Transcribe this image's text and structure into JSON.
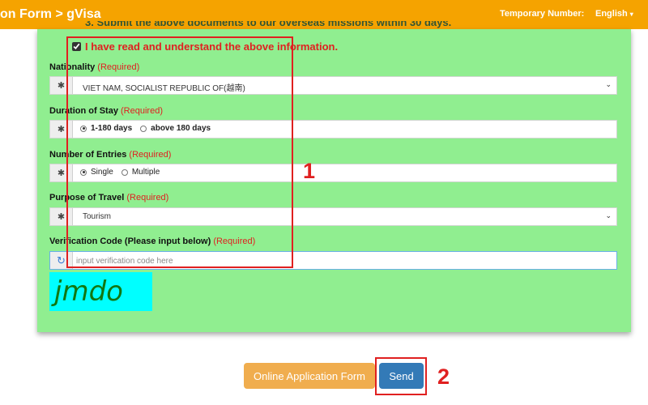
{
  "header": {
    "title": "on Form > gVisa",
    "temporary_label": "Temporary Number:",
    "language": "English",
    "language_caret": "▾"
  },
  "form": {
    "cut_off_text": "3. Submit the above documents to our overseas missions within 30 days.",
    "agree_text": "I have read and understand the above information.",
    "required_text": "(Required)",
    "nationality": {
      "label": "Nationality",
      "value": "VIET NAM, SOCIALIST REPUBLIC OF(越南)",
      "icon": "asterisk-icon"
    },
    "duration": {
      "label": "Duration of Stay",
      "options": [
        "1-180 days",
        "above 180 days"
      ],
      "selected": "1-180 days"
    },
    "entries": {
      "label": "Number of Entries",
      "options": [
        "Single",
        "Multiple"
      ],
      "selected": "Single"
    },
    "purpose": {
      "label": "Purpose of Travel",
      "value": "Tourism"
    },
    "verification": {
      "label": "Verification Code (Please input below)",
      "placeholder": "input verification code here",
      "captcha": "jmdo"
    },
    "addon_glyph": "✱",
    "refresh_glyph": "↻",
    "chevron_glyph": "⌄"
  },
  "buttons": {
    "online_form": "Online Application Form",
    "send": "Send"
  },
  "annotations": {
    "one": "1",
    "two": "2"
  },
  "colors": {
    "header": "#f5a300",
    "panel": "#90ee90",
    "required": "#e02020",
    "captcha_bg": "#00ffff",
    "send_button": "#337ab7",
    "online_button": "#f0ad4e"
  }
}
